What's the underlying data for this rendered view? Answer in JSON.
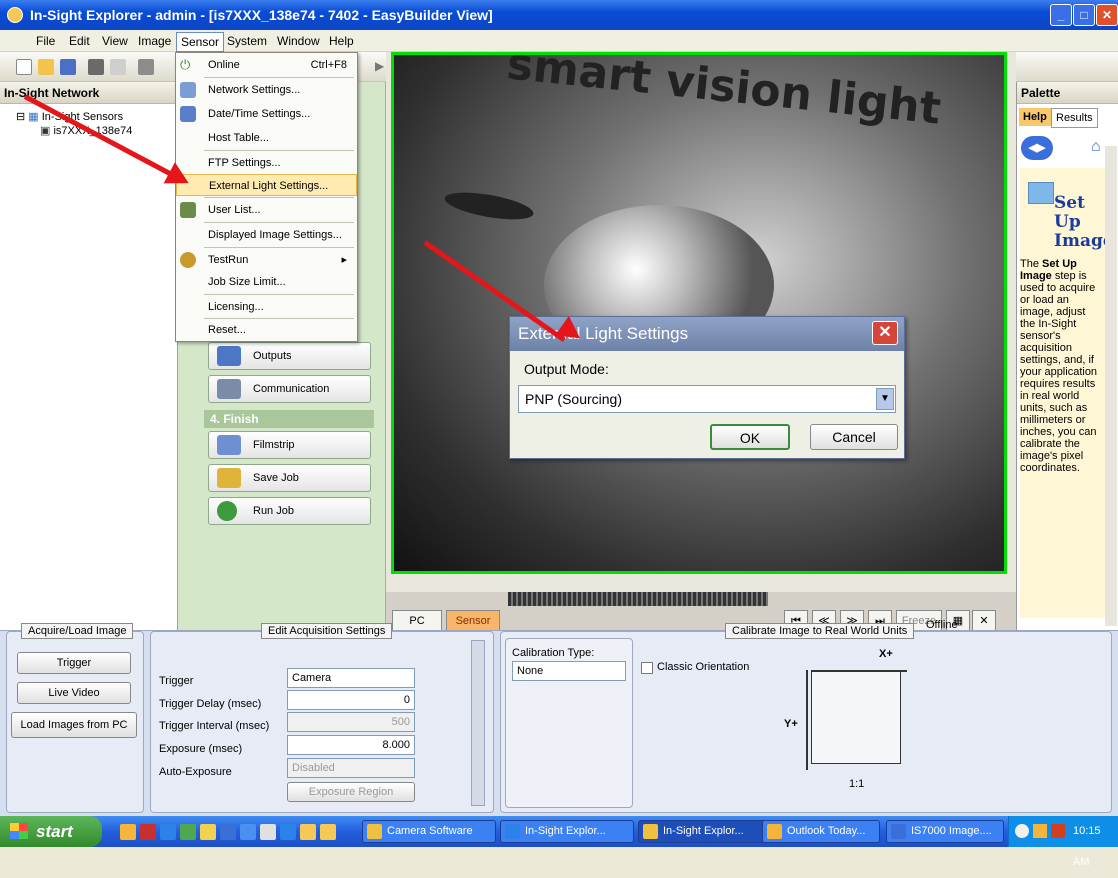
{
  "window": {
    "title": "In-Sight Explorer - admin - [is7XXX_138e74 - 7402 - EasyBuilder View]"
  },
  "menubar": [
    "File",
    "Edit",
    "View",
    "Image",
    "Sensor",
    "System",
    "Window",
    "Help"
  ],
  "sensor_menu": {
    "items": [
      {
        "label": "Online",
        "shortcut": "Ctrl+F8"
      },
      {
        "label": "Network Settings..."
      },
      {
        "label": "Date/Time Settings..."
      },
      {
        "label": "Host Table..."
      },
      {
        "label": "FTP Settings..."
      },
      {
        "label": "External Light Settings..."
      },
      {
        "label": "User List..."
      },
      {
        "label": "Displayed Image Settings..."
      },
      {
        "label": "TestRun"
      },
      {
        "label": "Job Size Limit..."
      },
      {
        "label": "Licensing..."
      },
      {
        "label": "Reset..."
      }
    ]
  },
  "left_pane": {
    "header": "In-Sight Network",
    "tree_root": "In-Sight Sensors",
    "tree_child": "is7XXX_138e74"
  },
  "steps": {
    "buttons": [
      "Outputs",
      "Communication"
    ],
    "finish_header": "4. Finish",
    "finish_buttons": [
      "Filmstrip",
      "Save Job",
      "Run Job"
    ]
  },
  "image": {
    "overlay_text": "smart vision light"
  },
  "image_bar": {
    "pc": "PC",
    "sensor": "Sensor",
    "freeze": "Freeze",
    "status": "Offline"
  },
  "palette": {
    "header": "Palette",
    "tabs": [
      "Help",
      "Results"
    ],
    "help_title": "Set Up Image",
    "help_text_bold": "Set Up Image",
    "help_text_pre": "The ",
    "help_text_post": " step is used to acquire or load an image, adjust the In-Sight sensor's acquisition settings, and, if your application requires results in real world units, such as millimeters or inches, you can calibrate the image's pixel coordinates."
  },
  "dialog": {
    "title": "External Light Settings",
    "output_mode_label": "Output Mode:",
    "output_mode_value": "PNP (Sourcing)",
    "ok": "OK",
    "cancel": "Cancel"
  },
  "acquire_group": {
    "title": "Acquire/Load Image",
    "buttons": [
      "Trigger",
      "Live Video",
      "Load Images from PC"
    ]
  },
  "acq_settings": {
    "title": "Edit Acquisition Settings",
    "rows": [
      {
        "label": "Trigger",
        "value": "Camera"
      },
      {
        "label": "Trigger Delay (msec)",
        "value": "0"
      },
      {
        "label": "Trigger Interval (msec)",
        "value": "500"
      },
      {
        "label": "Exposure (msec)",
        "value": "8.000"
      },
      {
        "label": "Auto-Exposure",
        "value": "Disabled"
      }
    ],
    "region_button": "Exposure Region"
  },
  "calibrate": {
    "title": "Calibrate Image to Real World Units",
    "type_label": "Calibration Type:",
    "type_value": "None",
    "classic_label": "Classic Orientation",
    "x_axis": "X+",
    "y_axis": "Y+",
    "ratio": "1:1"
  },
  "taskbar": {
    "start": "start",
    "tasks": [
      "Camera Software",
      "In-Sight Explor...",
      "In-Sight Explor...",
      "Outlook Today...",
      "IS7000 Image...."
    ],
    "clock": "10:15 AM"
  },
  "colors": {
    "accent": "#0A4CD6",
    "highlight": "#FFEBB0",
    "frame": "#00E000",
    "annotation": "#E4161A"
  }
}
